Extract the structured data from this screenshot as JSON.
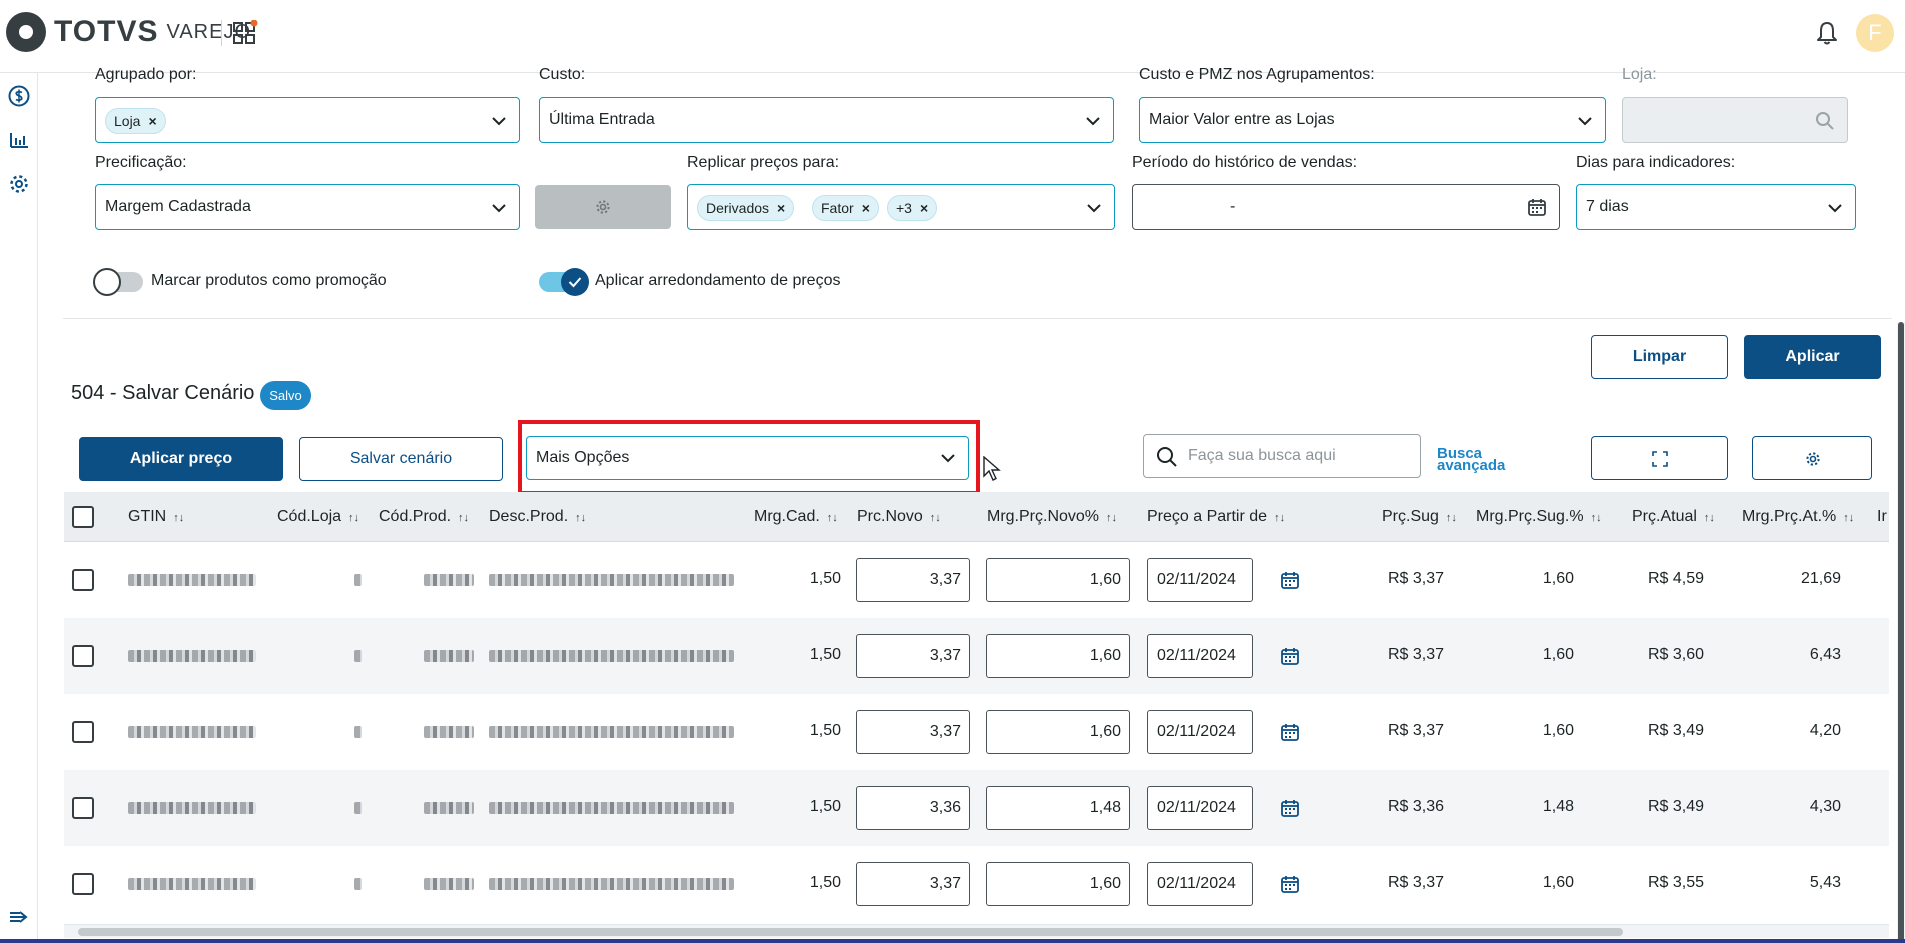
{
  "header": {
    "brand": "TOTVS",
    "product": "VAREJO",
    "avatar_initial": "F"
  },
  "filters": {
    "agrupado_label": "Agrupado por:",
    "agrupado_chip": "Loja",
    "custo_label": "Custo:",
    "custo_value": "Última Entrada",
    "custo_pmz_label": "Custo e PMZ nos Agrupamentos:",
    "custo_pmz_value": "Maior Valor entre as Lojas",
    "loja_label": "Loja:",
    "precificacao_label": "Precificação:",
    "precificacao_value": "Margem Cadastrada",
    "replicar_label": "Replicar preços para:",
    "replicar_chips": [
      "Derivados",
      "Fator",
      "+3"
    ],
    "periodo_label": "Período do histórico de vendas:",
    "periodo_value": "-",
    "dias_label": "Dias para indicadores:",
    "dias_value": "7 dias"
  },
  "toggles": {
    "promocao_label": "Marcar produtos como promoção",
    "promocao_on": false,
    "arredondamento_label": "Aplicar arredondamento de preços",
    "arredondamento_on": true
  },
  "actions": {
    "limpar": "Limpar",
    "aplicar": "Aplicar"
  },
  "scenario": {
    "title": "504 - Salvar Cenário",
    "status": "Salvo"
  },
  "toolbar": {
    "aplicar_preco": "Aplicar preço",
    "salvar_cenario": "Salvar cenário",
    "mais_opcoes": "Mais Opções",
    "search_placeholder": "Faça sua busca aqui",
    "busca_avancada_line1": "Busca",
    "busca_avancada_line2": "avançada"
  },
  "table": {
    "columns": [
      "GTIN",
      "Cód.Loja",
      "Cód.Prod.",
      "Desc.Prod.",
      "Mrg.Cad.",
      "Prc.Novo",
      "Mrg.Prç.Novo%",
      "Preço a Partir de",
      "Prç.Sug",
      "Mrg.Prç.Sug.%",
      "Prç.Atual",
      "Mrg.Prç.At.%",
      "Ir"
    ],
    "rows": [
      {
        "mrg_cad": "1,50",
        "prc_novo": "3,37",
        "mrg_novo": "1,60",
        "data": "02/11/2024",
        "prc_sug": "R$ 3,37",
        "mrg_sug": "1,60",
        "prc_atual": "R$ 4,59",
        "mrg_at": "21,69"
      },
      {
        "mrg_cad": "1,50",
        "prc_novo": "3,37",
        "mrg_novo": "1,60",
        "data": "02/11/2024",
        "prc_sug": "R$ 3,37",
        "mrg_sug": "1,60",
        "prc_atual": "R$ 3,60",
        "mrg_at": "6,43"
      },
      {
        "mrg_cad": "1,50",
        "prc_novo": "3,37",
        "mrg_novo": "1,60",
        "data": "02/11/2024",
        "prc_sug": "R$ 3,37",
        "mrg_sug": "1,60",
        "prc_atual": "R$ 3,49",
        "mrg_at": "4,20"
      },
      {
        "mrg_cad": "1,50",
        "prc_novo": "3,36",
        "mrg_novo": "1,48",
        "data": "02/11/2024",
        "prc_sug": "R$ 3,36",
        "mrg_sug": "1,48",
        "prc_atual": "R$ 3,49",
        "mrg_at": "4,30"
      },
      {
        "mrg_cad": "1,50",
        "prc_novo": "3,37",
        "mrg_novo": "1,60",
        "data": "02/11/2024",
        "prc_sug": "R$ 3,37",
        "mrg_sug": "1,60",
        "prc_atual": "R$ 3,55",
        "mrg_at": "5,43"
      }
    ]
  },
  "icons": {
    "rail": [
      "dollar-circle-icon",
      "bar-chart-icon",
      "gear-icon"
    ],
    "bottom_rail": "collapse-menu-icon"
  },
  "colors": {
    "primary": "#0c4f85",
    "accent": "#0c9abe",
    "badge": "#1d87c8",
    "highlight": "#e5161d"
  }
}
